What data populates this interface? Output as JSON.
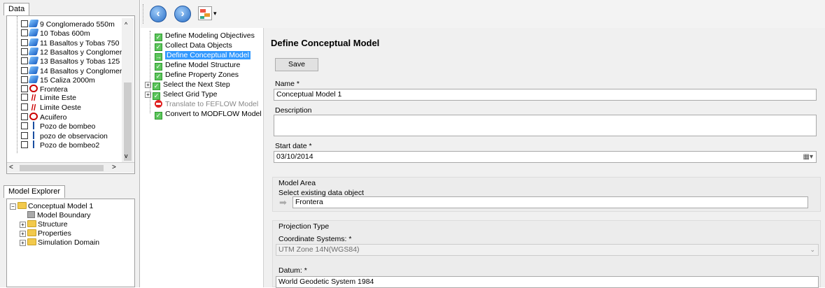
{
  "data_panel": {
    "tab": "Data",
    "items": [
      {
        "label": "9 Conglomerado 550m",
        "icon": "layer-icon"
      },
      {
        "label": "10 Tobas 600m",
        "icon": "layer-icon"
      },
      {
        "label": "11 Basaltos y Tobas 750",
        "icon": "layer-icon"
      },
      {
        "label": "12 Basaltos y Conglomer",
        "icon": "layer-icon"
      },
      {
        "label": "13 Basaltos y Tobas 125",
        "icon": "layer-icon"
      },
      {
        "label": "14 Basaltos y Conglomer",
        "icon": "layer-icon"
      },
      {
        "label": "15 Caliza 2000m",
        "icon": "layer-icon"
      },
      {
        "label": "Frontera",
        "icon": "polygon-icon"
      },
      {
        "label": "Limite Este",
        "icon": "polyline-icon"
      },
      {
        "label": "Limite Oeste",
        "icon": "polyline-icon"
      },
      {
        "label": "Acuifero",
        "icon": "polygon-icon"
      },
      {
        "label": "Pozo de bombeo",
        "icon": "well-icon"
      },
      {
        "label": "pozo de observacion",
        "icon": "well-icon"
      },
      {
        "label": "Pozo de bombeo2",
        "icon": "well-icon"
      }
    ]
  },
  "model_explorer": {
    "tab": "Model Explorer",
    "root": "Conceptual Model 1",
    "children": [
      "Model Boundary",
      "Structure",
      "Properties",
      "Simulation Domain"
    ]
  },
  "workflow": {
    "steps": [
      {
        "label": "Define Modeling Objectives",
        "state": "done"
      },
      {
        "label": "Collect Data Objects",
        "state": "done"
      },
      {
        "label": "Define  Conceptual Model",
        "state": "current"
      },
      {
        "label": "Define  Model Structure",
        "state": "done"
      },
      {
        "label": "Define  Property Zones",
        "state": "done"
      },
      {
        "label": "Select the Next Step",
        "state": "done",
        "expandable": true
      },
      {
        "label": "Select Grid Type",
        "state": "done",
        "expandable": true
      },
      {
        "label": "Translate to FEFLOW Model",
        "state": "disabled"
      },
      {
        "label": "Convert to MODFLOW Model",
        "state": "done"
      }
    ]
  },
  "form": {
    "title": "Define Conceptual Model",
    "save_label": "Save",
    "name_label": "Name *",
    "name_value": "Conceptual Model 1",
    "description_label": "Description",
    "description_value": "",
    "start_date_label": "Start date *",
    "start_date_value": "03/10/2014",
    "model_area": {
      "title": "Model Area",
      "select_label": "Select existing data object",
      "value": "Frontera"
    },
    "projection": {
      "title": "Projection Type",
      "coord_label": "Coordinate Systems: *",
      "coord_value": "UTM Zone 14N(WGS84)",
      "datum_label": "Datum: *",
      "datum_value": "World Geodetic System 1984"
    }
  },
  "colors": {
    "selection": "#3399ff",
    "check_green": "#5cc55c",
    "stop_red": "#e02020"
  }
}
